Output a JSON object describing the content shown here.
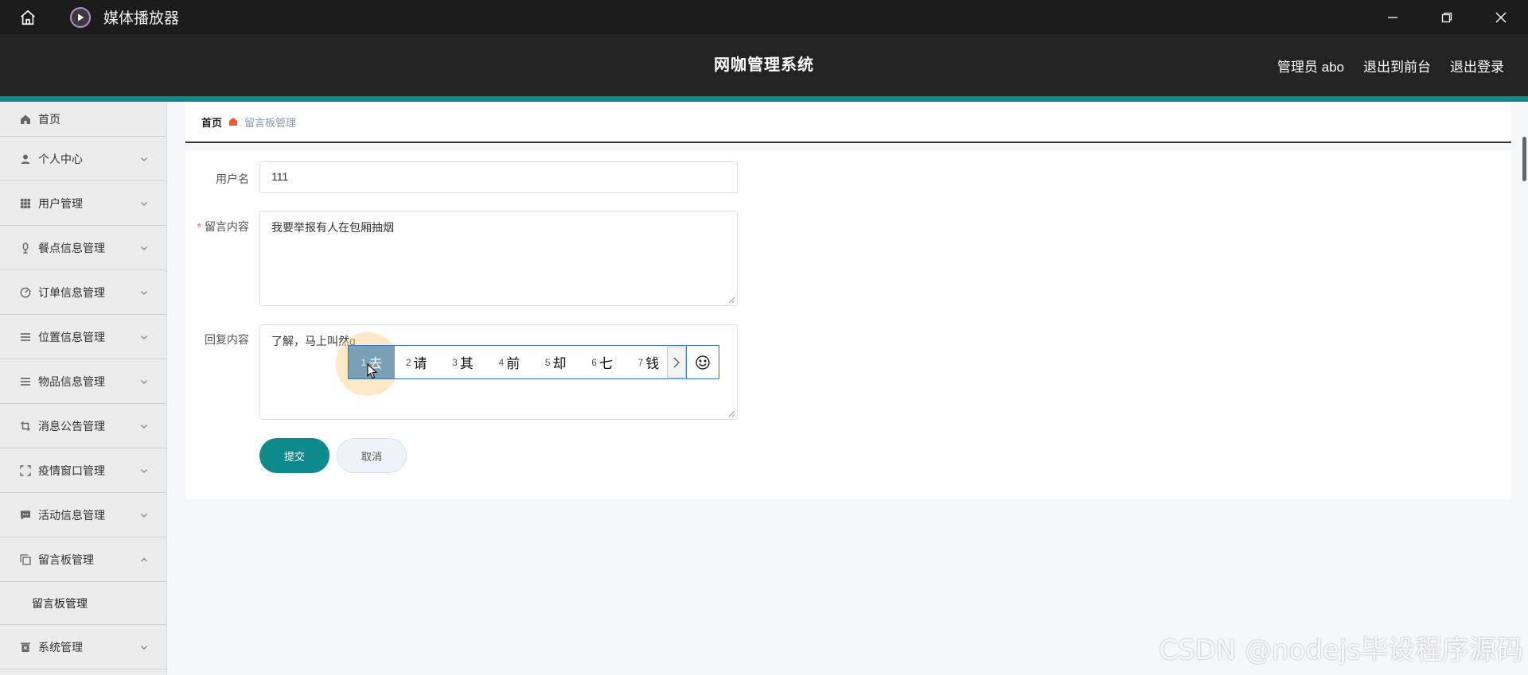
{
  "window": {
    "title": "媒体播放器",
    "home_icon": "home-icon",
    "app_icon": "play-icon",
    "controls": [
      "minimize-icon",
      "restore-icon",
      "close-icon"
    ]
  },
  "header": {
    "system_name": "网咖管理系统",
    "user_label": "管理员 abo",
    "to_frontend": "退出到前台",
    "logout": "退出登录"
  },
  "sidebar": {
    "items": [
      {
        "label": "首页",
        "icon": "home-icon"
      },
      {
        "label": "个人中心",
        "icon": "user-icon"
      },
      {
        "label": "用户管理",
        "icon": "grid-icon"
      },
      {
        "label": "餐点信息管理",
        "icon": "microphone-icon"
      },
      {
        "label": "订单信息管理",
        "icon": "gauge-icon"
      },
      {
        "label": "位置信息管理",
        "icon": "list-icon"
      },
      {
        "label": "物品信息管理",
        "icon": "list-icon"
      },
      {
        "label": "消息公告管理",
        "icon": "crop-icon"
      },
      {
        "label": "疫情窗口管理",
        "icon": "fullscreen-icon"
      },
      {
        "label": "活动信息管理",
        "icon": "chat-icon"
      },
      {
        "label": "留言板管理",
        "icon": "copy-icon"
      }
    ],
    "sub_item": "留言板管理",
    "last_item": {
      "label": "系统管理",
      "icon": "trash-icon"
    }
  },
  "breadcrumb": {
    "home": "首页",
    "current": "留言板管理"
  },
  "form": {
    "username_label": "用户名",
    "username_value": "111",
    "required_mark": "*",
    "message_label": "留言内容",
    "message_value": "我要举报有人在包厢抽烟",
    "reply_label": "回复内容",
    "reply_value": "了解，马上叫然q",
    "submit": "提交",
    "cancel": "取消"
  },
  "ime": {
    "candidates": [
      {
        "num": "1",
        "text": "去"
      },
      {
        "num": "2",
        "text": "请"
      },
      {
        "num": "3",
        "text": "其"
      },
      {
        "num": "4",
        "text": "前"
      },
      {
        "num": "5",
        "text": "却"
      },
      {
        "num": "6",
        "text": "七"
      },
      {
        "num": "7",
        "text": "钱"
      }
    ],
    "selected_index": 0
  },
  "watermark": "CSDN @nodejs毕设程序源码",
  "colors": {
    "accent": "#0e8a8c",
    "header_bg": "#232323",
    "titlebar_bg": "#1c1c1c",
    "sidebar_bg": "#ececec"
  }
}
